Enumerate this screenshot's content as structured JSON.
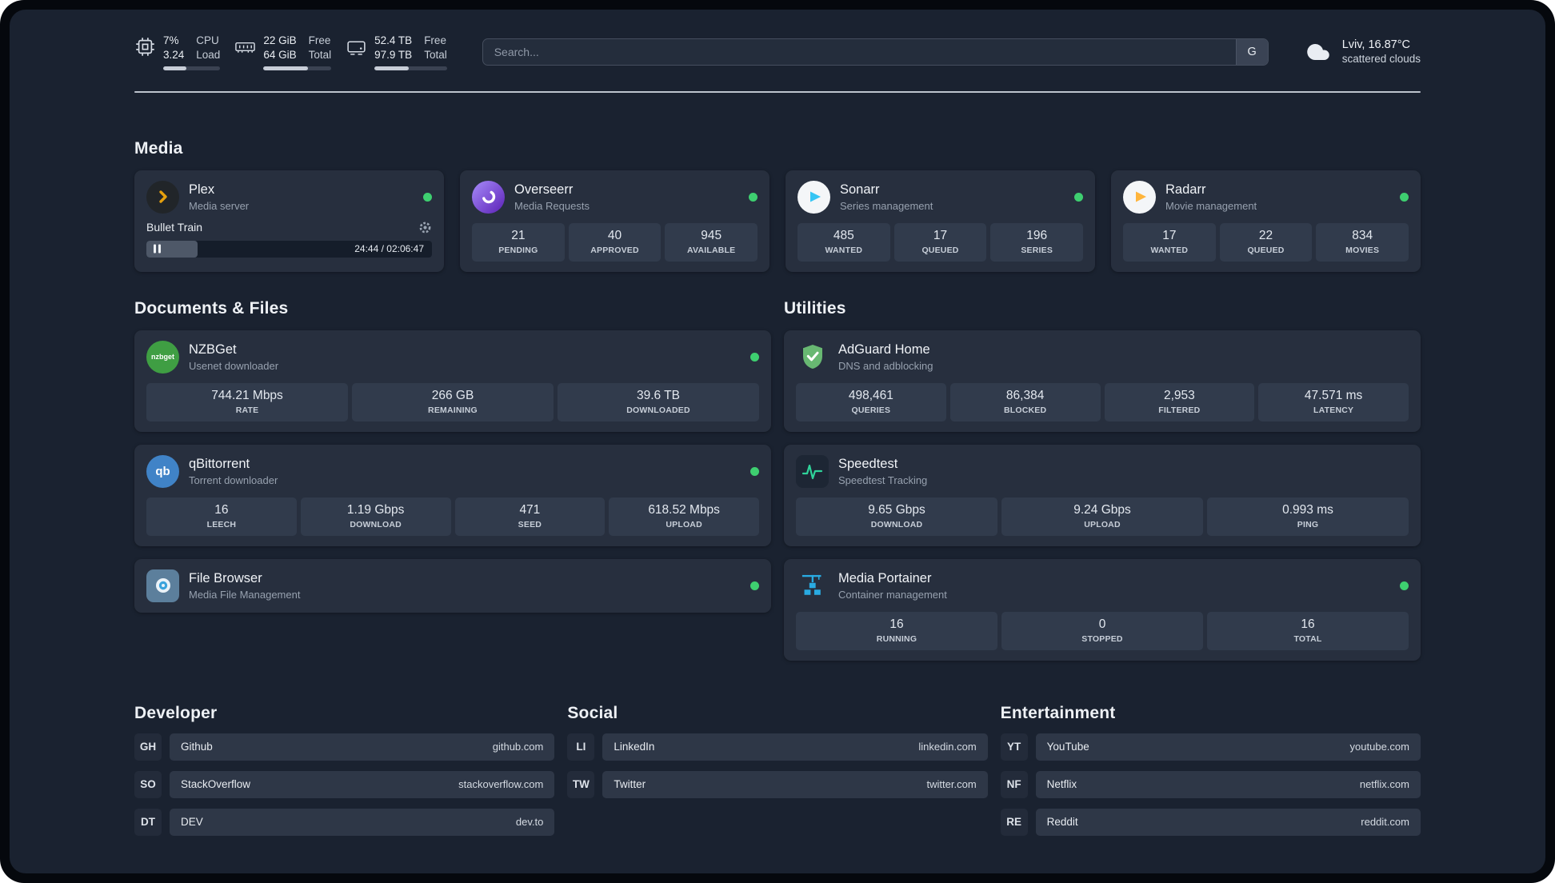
{
  "topbar": {
    "cpu": {
      "value": "7%",
      "sub": "3.24",
      "label1": "CPU",
      "label2": "Load",
      "bar": 40
    },
    "ram": {
      "value": "22 GiB",
      "sub": "64 GiB",
      "label1": "Free",
      "label2": "Total",
      "bar": 66
    },
    "disk": {
      "value": "52.4 TB",
      "sub": "97.9 TB",
      "label1": "Free",
      "label2": "Total",
      "bar": 47
    },
    "search": {
      "placeholder": "Search...",
      "engine": "G"
    },
    "weather": {
      "location": "Lviv, 16.87°C",
      "condition": "scattered clouds"
    }
  },
  "sections": {
    "media": {
      "title": "Media",
      "apps": [
        {
          "name": "Plex",
          "desc": "Media server",
          "player": {
            "title": "Bullet Train",
            "time": "24:44 / 02:06:47",
            "progress": 18
          }
        },
        {
          "name": "Overseerr",
          "desc": "Media Requests",
          "stats": [
            {
              "v": "21",
              "l": "PENDING"
            },
            {
              "v": "40",
              "l": "APPROVED"
            },
            {
              "v": "945",
              "l": "AVAILABLE"
            }
          ]
        },
        {
          "name": "Sonarr",
          "desc": "Series management",
          "stats": [
            {
              "v": "485",
              "l": "WANTED"
            },
            {
              "v": "17",
              "l": "QUEUED"
            },
            {
              "v": "196",
              "l": "SERIES"
            }
          ]
        },
        {
          "name": "Radarr",
          "desc": "Movie management",
          "stats": [
            {
              "v": "17",
              "l": "WANTED"
            },
            {
              "v": "22",
              "l": "QUEUED"
            },
            {
              "v": "834",
              "l": "MOVIES"
            }
          ]
        }
      ]
    },
    "documents": {
      "title": "Documents & Files",
      "apps": [
        {
          "name": "NZBGet",
          "desc": "Usenet downloader",
          "stats": [
            {
              "v": "744.21 Mbps",
              "l": "RATE"
            },
            {
              "v": "266 GB",
              "l": "REMAINING"
            },
            {
              "v": "39.6 TB",
              "l": "DOWNLOADED"
            }
          ]
        },
        {
          "name": "qBittorrent",
          "desc": "Torrent downloader",
          "stats": [
            {
              "v": "16",
              "l": "LEECH"
            },
            {
              "v": "1.19 Gbps",
              "l": "DOWNLOAD"
            },
            {
              "v": "471",
              "l": "SEED"
            },
            {
              "v": "618.52 Mbps",
              "l": "UPLOAD"
            }
          ]
        },
        {
          "name": "File Browser",
          "desc": "Media File Management"
        }
      ]
    },
    "utilities": {
      "title": "Utilities",
      "apps": [
        {
          "name": "AdGuard Home",
          "desc": "DNS and adblocking",
          "stats": [
            {
              "v": "498,461",
              "l": "QUERIES"
            },
            {
              "v": "86,384",
              "l": "BLOCKED"
            },
            {
              "v": "2,953",
              "l": "FILTERED"
            },
            {
              "v": "47.571 ms",
              "l": "LATENCY"
            }
          ]
        },
        {
          "name": "Speedtest",
          "desc": "Speedtest Tracking",
          "stats": [
            {
              "v": "9.65 Gbps",
              "l": "DOWNLOAD"
            },
            {
              "v": "9.24 Gbps",
              "l": "UPLOAD"
            },
            {
              "v": "0.993 ms",
              "l": "PING"
            }
          ]
        },
        {
          "name": "Media Portainer",
          "desc": "Container management",
          "stats": [
            {
              "v": "16",
              "l": "RUNNING"
            },
            {
              "v": "0",
              "l": "STOPPED"
            },
            {
              "v": "16",
              "l": "TOTAL"
            }
          ]
        }
      ]
    }
  },
  "bookmarks": [
    {
      "title": "Developer",
      "items": [
        {
          "abbr": "GH",
          "name": "Github",
          "url": "github.com"
        },
        {
          "abbr": "SO",
          "name": "StackOverflow",
          "url": "stackoverflow.com"
        },
        {
          "abbr": "DT",
          "name": "DEV",
          "url": "dev.to"
        }
      ]
    },
    {
      "title": "Social",
      "items": [
        {
          "abbr": "LI",
          "name": "LinkedIn",
          "url": "linkedin.com"
        },
        {
          "abbr": "TW",
          "name": "Twitter",
          "url": "twitter.com"
        }
      ]
    },
    {
      "title": "Entertainment",
      "items": [
        {
          "abbr": "YT",
          "name": "YouTube",
          "url": "youtube.com"
        },
        {
          "abbr": "NF",
          "name": "Netflix",
          "url": "netflix.com"
        },
        {
          "abbr": "RE",
          "name": "Reddit",
          "url": "reddit.com"
        }
      ]
    }
  ],
  "icon_labels": {
    "nzbget": "nzbget",
    "qbittorrent": "qb"
  },
  "colors": {
    "status_online": "#3ecf70",
    "accent_plex": "#e5a00d"
  }
}
